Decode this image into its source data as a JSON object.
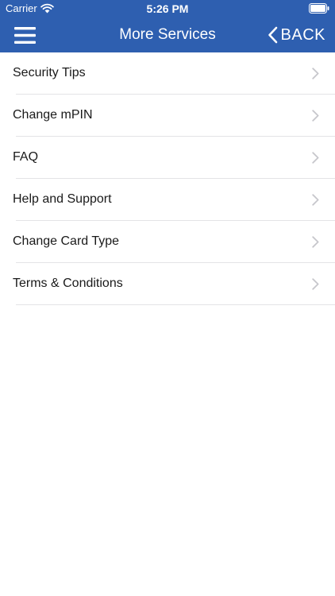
{
  "status_bar": {
    "carrier": "Carrier",
    "time": "5:26 PM"
  },
  "nav_bar": {
    "menu_icon": "hamburger-menu-icon",
    "title": "More Services",
    "back_icon": "chevron-left-icon",
    "back_label": "BACK"
  },
  "menu_items": [
    {
      "label": "Security Tips"
    },
    {
      "label": "Change mPIN"
    },
    {
      "label": "FAQ"
    },
    {
      "label": "Help and Support"
    },
    {
      "label": "Change Card Type"
    },
    {
      "label": "Terms & Conditions"
    }
  ],
  "colors": {
    "header_background": "#2e5fb0",
    "header_text": "#ffffff",
    "row_text": "#1a1a1a",
    "separator": "#e3e3e6",
    "chevron": "#c7c7cc"
  }
}
